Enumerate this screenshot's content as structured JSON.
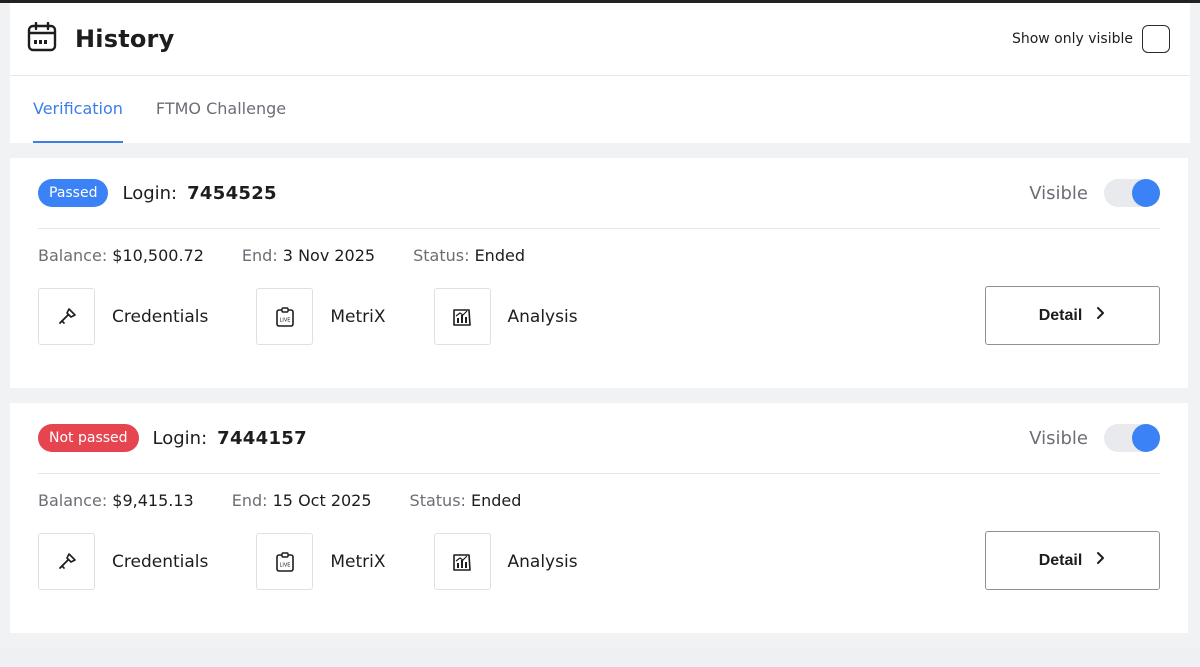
{
  "header": {
    "title": "History",
    "show_only_visible_label": "Show only visible",
    "show_only_visible_checked": false
  },
  "tabs": [
    {
      "label": "Verification",
      "active": true
    },
    {
      "label": "FTMO Challenge",
      "active": false
    }
  ],
  "colors": {
    "accent": "#3b7ee8",
    "passed": "#3b82f6",
    "not_passed": "#e64550"
  },
  "accounts": [
    {
      "status_badge": "Passed",
      "badge_color": "#3b82f6",
      "login_label": "Login:",
      "login": "7454525",
      "visible_label": "Visible",
      "visible": true,
      "balance_label": "Balance:",
      "balance": "$10,500.72",
      "end_label": "End:",
      "end": "3 Nov 2025",
      "status_label": "Status:",
      "status": "Ended",
      "actions": [
        {
          "label": "Credentials",
          "icon": "key-icon"
        },
        {
          "label": "MetriX",
          "icon": "live-clipboard-icon"
        },
        {
          "label": "Analysis",
          "icon": "chart-icon"
        }
      ],
      "detail_label": "Detail"
    },
    {
      "status_badge": "Not passed",
      "badge_color": "#e64550",
      "login_label": "Login:",
      "login": "7444157",
      "visible_label": "Visible",
      "visible": true,
      "balance_label": "Balance:",
      "balance": "$9,415.13",
      "end_label": "End:",
      "end": "15 Oct 2025",
      "status_label": "Status:",
      "status": "Ended",
      "actions": [
        {
          "label": "Credentials",
          "icon": "key-icon"
        },
        {
          "label": "MetriX",
          "icon": "live-clipboard-icon"
        },
        {
          "label": "Analysis",
          "icon": "chart-icon"
        }
      ],
      "detail_label": "Detail"
    }
  ]
}
